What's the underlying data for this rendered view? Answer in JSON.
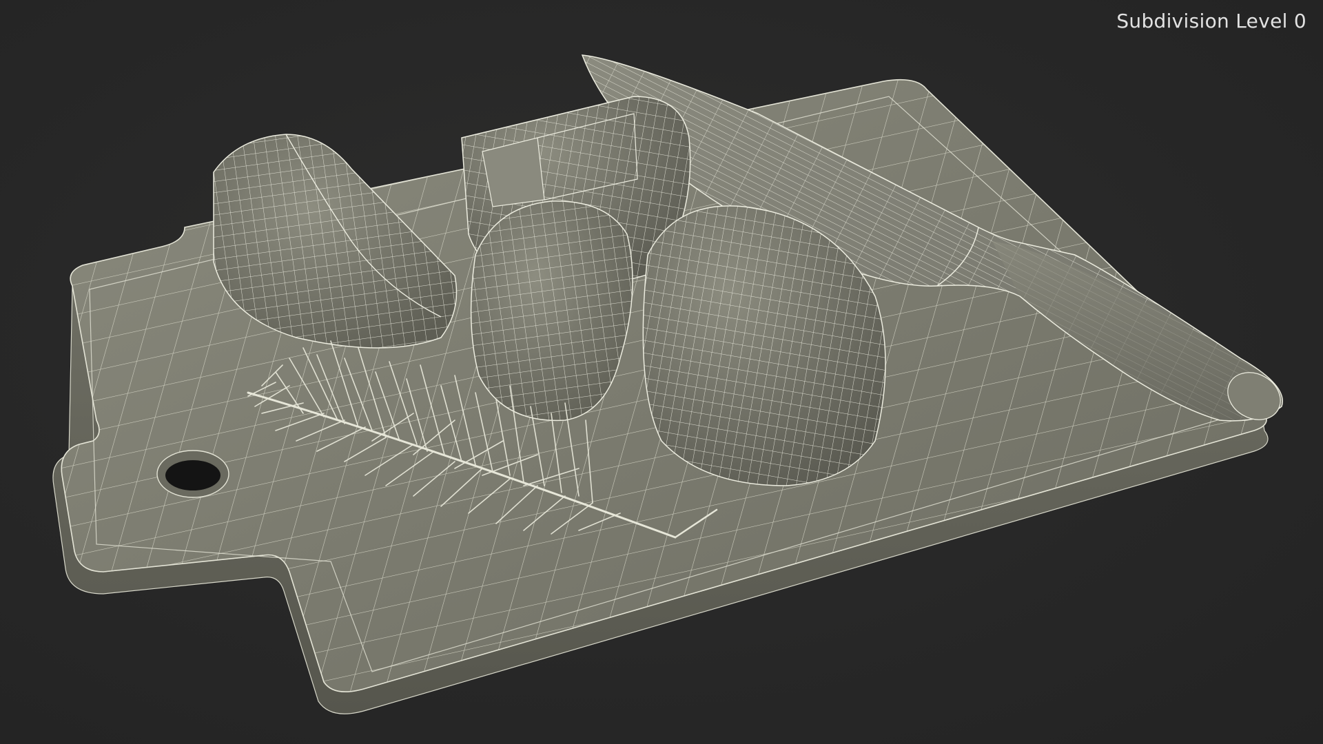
{
  "viewport": {
    "overlay_label": "Subdivision Level 0",
    "background_color": "#282828",
    "render_mode": "wireframe-on-shaded",
    "surface_color": "#7a7a6e",
    "wire_color": "#ececdf"
  },
  "scene": {
    "objects": [
      {
        "name": "cutting-board",
        "description": "rectangular board with handle and hole"
      },
      {
        "name": "knife",
        "description": "kitchen knife lying diagonally"
      },
      {
        "name": "garlic-cloves",
        "description": "four cut garlic pieces"
      },
      {
        "name": "rosemary-sprig",
        "description": "sprig with needle leaves"
      }
    ]
  }
}
